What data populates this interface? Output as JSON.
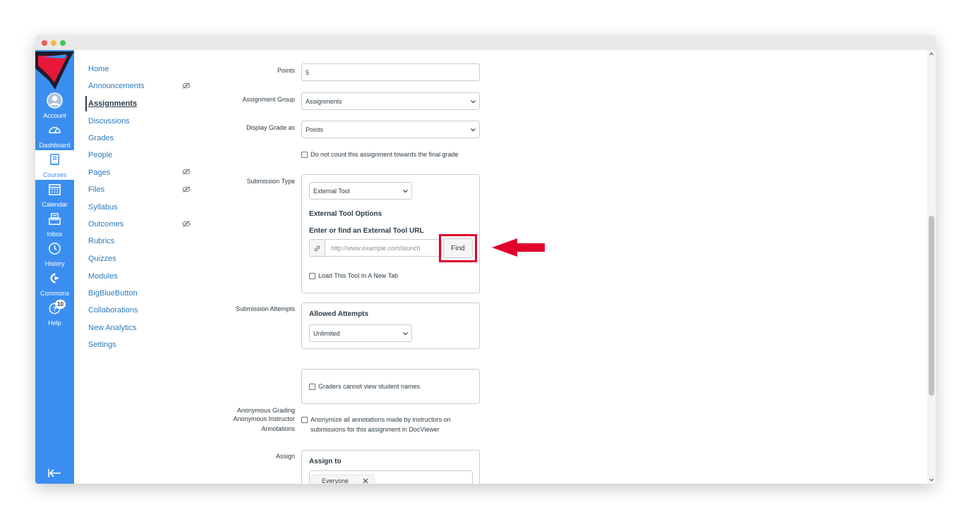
{
  "colors": {
    "accent": "#3b8ef0",
    "link": "#2b7abc",
    "highlight": "#e0002b",
    "text": "#2d3b45"
  },
  "global_nav": {
    "items": [
      {
        "label": "Account",
        "icon": "account-icon"
      },
      {
        "label": "Dashboard",
        "icon": "dashboard-icon"
      },
      {
        "label": "Courses",
        "icon": "courses-icon"
      },
      {
        "label": "Calendar",
        "icon": "calendar-icon"
      },
      {
        "label": "Inbox",
        "icon": "inbox-icon"
      },
      {
        "label": "History",
        "icon": "history-icon"
      },
      {
        "label": "Commons",
        "icon": "commons-icon"
      },
      {
        "label": "Help",
        "icon": "help-icon",
        "badge": "10"
      }
    ]
  },
  "course_nav": {
    "items": [
      {
        "label": "Home"
      },
      {
        "label": "Announcements",
        "hidden": true
      },
      {
        "label": "Assignments",
        "active": true
      },
      {
        "label": "Discussions"
      },
      {
        "label": "Grades"
      },
      {
        "label": "People"
      },
      {
        "label": "Pages",
        "hidden": true
      },
      {
        "label": "Files",
        "hidden": true
      },
      {
        "label": "Syllabus"
      },
      {
        "label": "Outcomes",
        "hidden": true
      },
      {
        "label": "Rubrics"
      },
      {
        "label": "Quizzes"
      },
      {
        "label": "Modules"
      },
      {
        "label": "BigBlueButton"
      },
      {
        "label": "Collaborations"
      },
      {
        "label": "New Analytics"
      },
      {
        "label": "Settings"
      }
    ]
  },
  "form": {
    "points": {
      "label": "Points",
      "value": "5"
    },
    "assignment_group": {
      "label": "Assignment Group",
      "value": "Assignments"
    },
    "display_grade": {
      "label": "Display Grade as",
      "value": "Points"
    },
    "no_count": {
      "label": "Do not count this assignment towards the final grade"
    },
    "submission_type": {
      "label": "Submission Type",
      "value": "External Tool",
      "options_title": "External Tool Options",
      "url_title": "Enter or find an External Tool URL",
      "url_placeholder": "http://www.example.com/launch",
      "find_label": "Find",
      "new_tab_label": "Load This Tool In A New Tab"
    },
    "submission_attempts": {
      "label": "Submission Attempts",
      "allowed_title": "Allowed Attempts",
      "value": "Unlimited"
    },
    "anonymous_grading": {
      "label": "Anonymous Grading",
      "option": "Graders cannot view student names"
    },
    "anonymous_instructor": {
      "label_line1": "Anonymous Instructor",
      "label_line2": "Annotations",
      "option_line1": "Anonymize all annotations made by instructors on",
      "option_line2": "submissions for this assignment in DocViewer"
    },
    "assign": {
      "label": "Assign",
      "assign_to_title": "Assign to",
      "chip": "Everyone"
    }
  }
}
